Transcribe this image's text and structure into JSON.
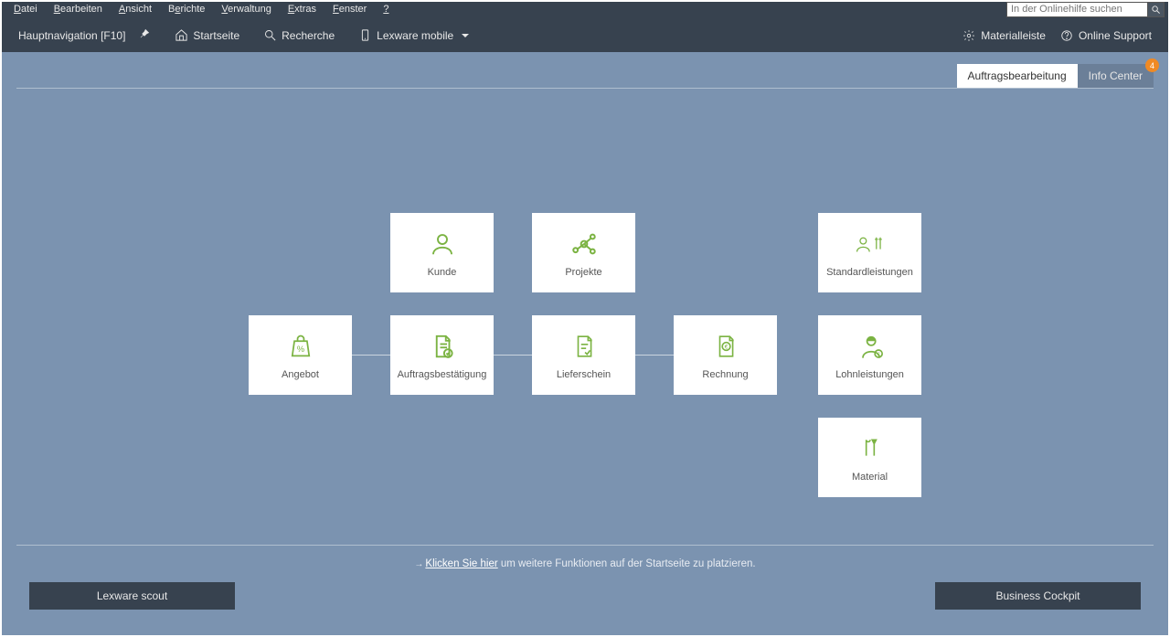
{
  "menu": {
    "items": [
      "Datei",
      "Bearbeiten",
      "Ansicht",
      "Berichte",
      "Verwaltung",
      "Extras",
      "Fenster",
      "?"
    ]
  },
  "search": {
    "placeholder": "In der Onlinehilfe suchen"
  },
  "toolbar": {
    "nav_label": "Hauptnavigation [F10]",
    "startseite": "Startseite",
    "recherche": "Recherche",
    "lexware_mobile": "Lexware mobile",
    "materialleiste": "Materialleiste",
    "online_support": "Online Support"
  },
  "tabs": {
    "active": "Auftragsbearbeitung",
    "inactive": "Info Center",
    "badge": "4"
  },
  "tiles": {
    "kunde": "Kunde",
    "projekte": "Projekte",
    "standardleistungen": "Standardleistungen",
    "angebot": "Angebot",
    "auftragsbestaetigung": "Auftragsbestätigung",
    "lieferschein": "Lieferschein",
    "rechnung": "Rechnung",
    "lohnleistungen": "Lohnleistungen",
    "material": "Material"
  },
  "hint": {
    "link": "Klicken Sie hier",
    "rest": " um weitere Funktionen auf der Startseite zu platzieren."
  },
  "bottom": {
    "left": "Lexware scout",
    "right": "Business Cockpit"
  },
  "colors": {
    "accent": "#7bb342",
    "bg": "#7b93b0",
    "dark": "#37424f",
    "badge": "#f08a24"
  }
}
